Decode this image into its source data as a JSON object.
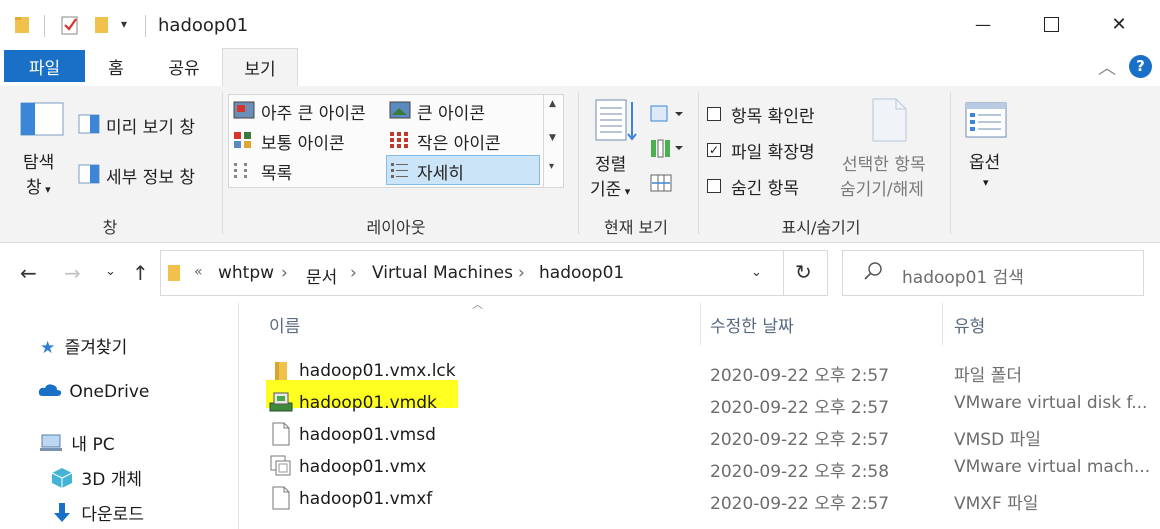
{
  "window": {
    "title": "hadoop01",
    "minimize_glyph": "—",
    "maximize_glyph": "☐",
    "close_glyph": "✕"
  },
  "quick_access": {
    "icons": [
      "folder-icon",
      "properties-check-icon",
      "new-folder-icon",
      "customize-dropdown-icon"
    ]
  },
  "ribbon_tabs": {
    "file": "파일",
    "home": "홈",
    "share": "공유",
    "view": "보기",
    "active": "보기"
  },
  "ribbon": {
    "panes": {
      "nav_pane_line1": "탐색",
      "nav_pane_line2": "창",
      "preview_pane": "미리 보기 창",
      "details_pane": "세부 정보 창",
      "group_label": "창"
    },
    "layout": {
      "extra_large_icons": "아주 큰 아이콘",
      "large_icons": "큰 아이콘",
      "medium_icons": "보통 아이콘",
      "small_icons": "작은 아이콘",
      "list": "목록",
      "details": "자세히",
      "selected": "자세히",
      "group_label": "레이아웃"
    },
    "current_view": {
      "sort_line1": "정렬",
      "sort_line2": "기준",
      "group_label": "현재 보기"
    },
    "show_hide": {
      "item_check_boxes": "항목 확인란",
      "item_check_boxes_checked": false,
      "file_name_extensions": "파일 확장명",
      "file_name_extensions_checked": true,
      "hidden_items": "숨긴 항목",
      "hidden_items_checked": false,
      "hide_selected_line1": "선택한 항목",
      "hide_selected_line2": "숨기기/해제",
      "group_label": "표시/숨기기"
    },
    "options": {
      "label": "옵션"
    }
  },
  "address": {
    "overflow": "«",
    "crumbs": [
      "whtpw",
      "문서",
      "Virtual Machines",
      "hadoop01"
    ],
    "separator": "›"
  },
  "search": {
    "placeholder": "hadoop01 검색"
  },
  "nav_pane": {
    "items": [
      {
        "label": "즐겨찾기",
        "icon": "star-icon"
      },
      {
        "label": "OneDrive",
        "icon": "cloud-icon"
      },
      {
        "label": "내 PC",
        "icon": "computer-icon"
      },
      {
        "label": "3D 개체",
        "icon": "cube-icon"
      },
      {
        "label": "다운로드",
        "icon": "download-arrow-icon"
      }
    ]
  },
  "file_list": {
    "columns": {
      "name": "이름",
      "modified": "수정한 날짜",
      "type": "유형"
    },
    "rows": [
      {
        "name": "hadoop01.vmx.lck",
        "modified": "2020-09-22 오후 2:57",
        "type": "파일 폴더",
        "icon": "folder-icon"
      },
      {
        "name": "hadoop01.vmdk",
        "modified": "2020-09-22 오후 2:57",
        "type": "VMware virtual disk f...",
        "icon": "vmware-disk-icon",
        "highlighted": true
      },
      {
        "name": "hadoop01.vmsd",
        "modified": "2020-09-22 오후 2:57",
        "type": "VMSD 파일",
        "icon": "file-icon"
      },
      {
        "name": "hadoop01.vmx",
        "modified": "2020-09-22 오후 2:58",
        "type": "VMware virtual mach...",
        "icon": "vmware-config-icon"
      },
      {
        "name": "hadoop01.vmxf",
        "modified": "2020-09-22 오후 2:57",
        "type": "VMXF 파일",
        "icon": "file-icon"
      }
    ]
  },
  "colors": {
    "file_tab": "#1a6fc6",
    "ribbon_bg": "#f3f3f3",
    "highlight": "#ffff22",
    "selected_layout": "#cce4f7",
    "help": "#1a6fc6"
  }
}
